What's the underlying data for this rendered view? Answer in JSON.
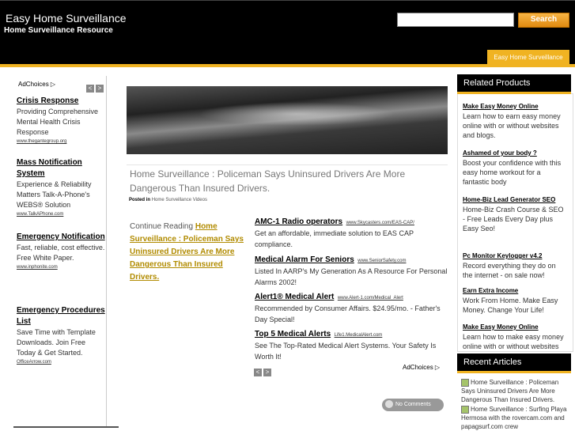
{
  "header": {
    "site_title": "Easy Home Surveillance",
    "site_subtitle": "Home Surveillance Resource",
    "search_placeholder": "",
    "search_button": "Search",
    "nav_tab": "Easy Home Surveillance"
  },
  "left_ads": {
    "adchoices": "AdChoices",
    "items": [
      {
        "title": "Crisis Response",
        "desc": "Providing Comprehensive Mental Health Crisis Response",
        "url": "www.thegantegroup.org"
      },
      {
        "title": "Mass Notification System",
        "desc": "Experience & Reliability Matters Talk-A-Phone's WEBS® Solution",
        "url": "www.TalkAPhone.com"
      },
      {
        "title": "Emergency Notification",
        "desc": "Fast, reliable, cost effective. Free White Paper.",
        "url": "www.inphonite.com"
      },
      {
        "title": "Emergency Procedures List",
        "desc": "Save Time with Template Downloads. Join Free Today & Get Started.",
        "url": "OfficeArrow.com"
      }
    ]
  },
  "post": {
    "title": "Home Surveillance : Policeman Says Uninsured Drivers Are More Dangerous Than Insured Drivers.",
    "posted_in_label": "Posted in",
    "category": "Home Surveillance Videos",
    "continue_label": "Continue Reading",
    "continue_link": "Home Surveillance : Policeman Says Uninsured Drivers Are More Dangerous Than Insured Drivers.",
    "no_comments": "No Comments"
  },
  "mid_ads": {
    "adchoices": "AdChoices",
    "items": [
      {
        "title": "AMC-1 Radio operators",
        "url": "www.Skycasters.com/EAS-CAP/",
        "desc": "Get an affordable, immediate solution to EAS CAP compliance."
      },
      {
        "title": "Medical Alarm For Seniors",
        "url": "www.SeniorSafety.com",
        "desc": "Listed In AARP's My Generation As A Resource For Personal Alarms 2002!"
      },
      {
        "title": "Alert1® Medical Alert",
        "url": "www.Alert-1.com/Medical_Alert",
        "desc": "Recommended by Consumer Affairs. $24.95/mo. - Father's Day Special!"
      },
      {
        "title": "Top 5 Medical Alerts",
        "url": "Life1.MedicalAlert.com",
        "desc": "See The Top-Rated Medical Alert Systems. Your Safety Is Worth It!"
      }
    ]
  },
  "sidebar": {
    "related_heading": "Related Products",
    "related": [
      {
        "title": "Make Easy Money Online",
        "desc": "Learn how to earn easy money online with or without websites and blogs."
      },
      {
        "title": "Ashamed of your body ?",
        "desc": "Boost your confidence with this easy home workout for a fantastic body"
      },
      {
        "title": "Home-Biz Lead Generator SEO",
        "desc": "Home-Biz Crash Course & SEO - Free Leads Every Day plus Easy Seo!"
      },
      {
        "title": "Pc Monitor Keylogger v4.2",
        "desc": "Record everything they do on the internet - on sale now!"
      },
      {
        "title": "Earn Extra Income",
        "desc": "Work From Home. Make Easy Money. Change Your Life!"
      },
      {
        "title": "Make Easy Money Online",
        "desc": "Learn how to make easy money online with or without websites"
      }
    ],
    "recent_heading": "Recent Articles",
    "recent": [
      "Home Surveillance : Policeman Says Uninsured Drivers Are More Dangerous Than Insured Drivers.",
      "Home Surveillance : Surfing Playa Hermosa with the rovercam.com and papagsurf.com crew"
    ]
  }
}
